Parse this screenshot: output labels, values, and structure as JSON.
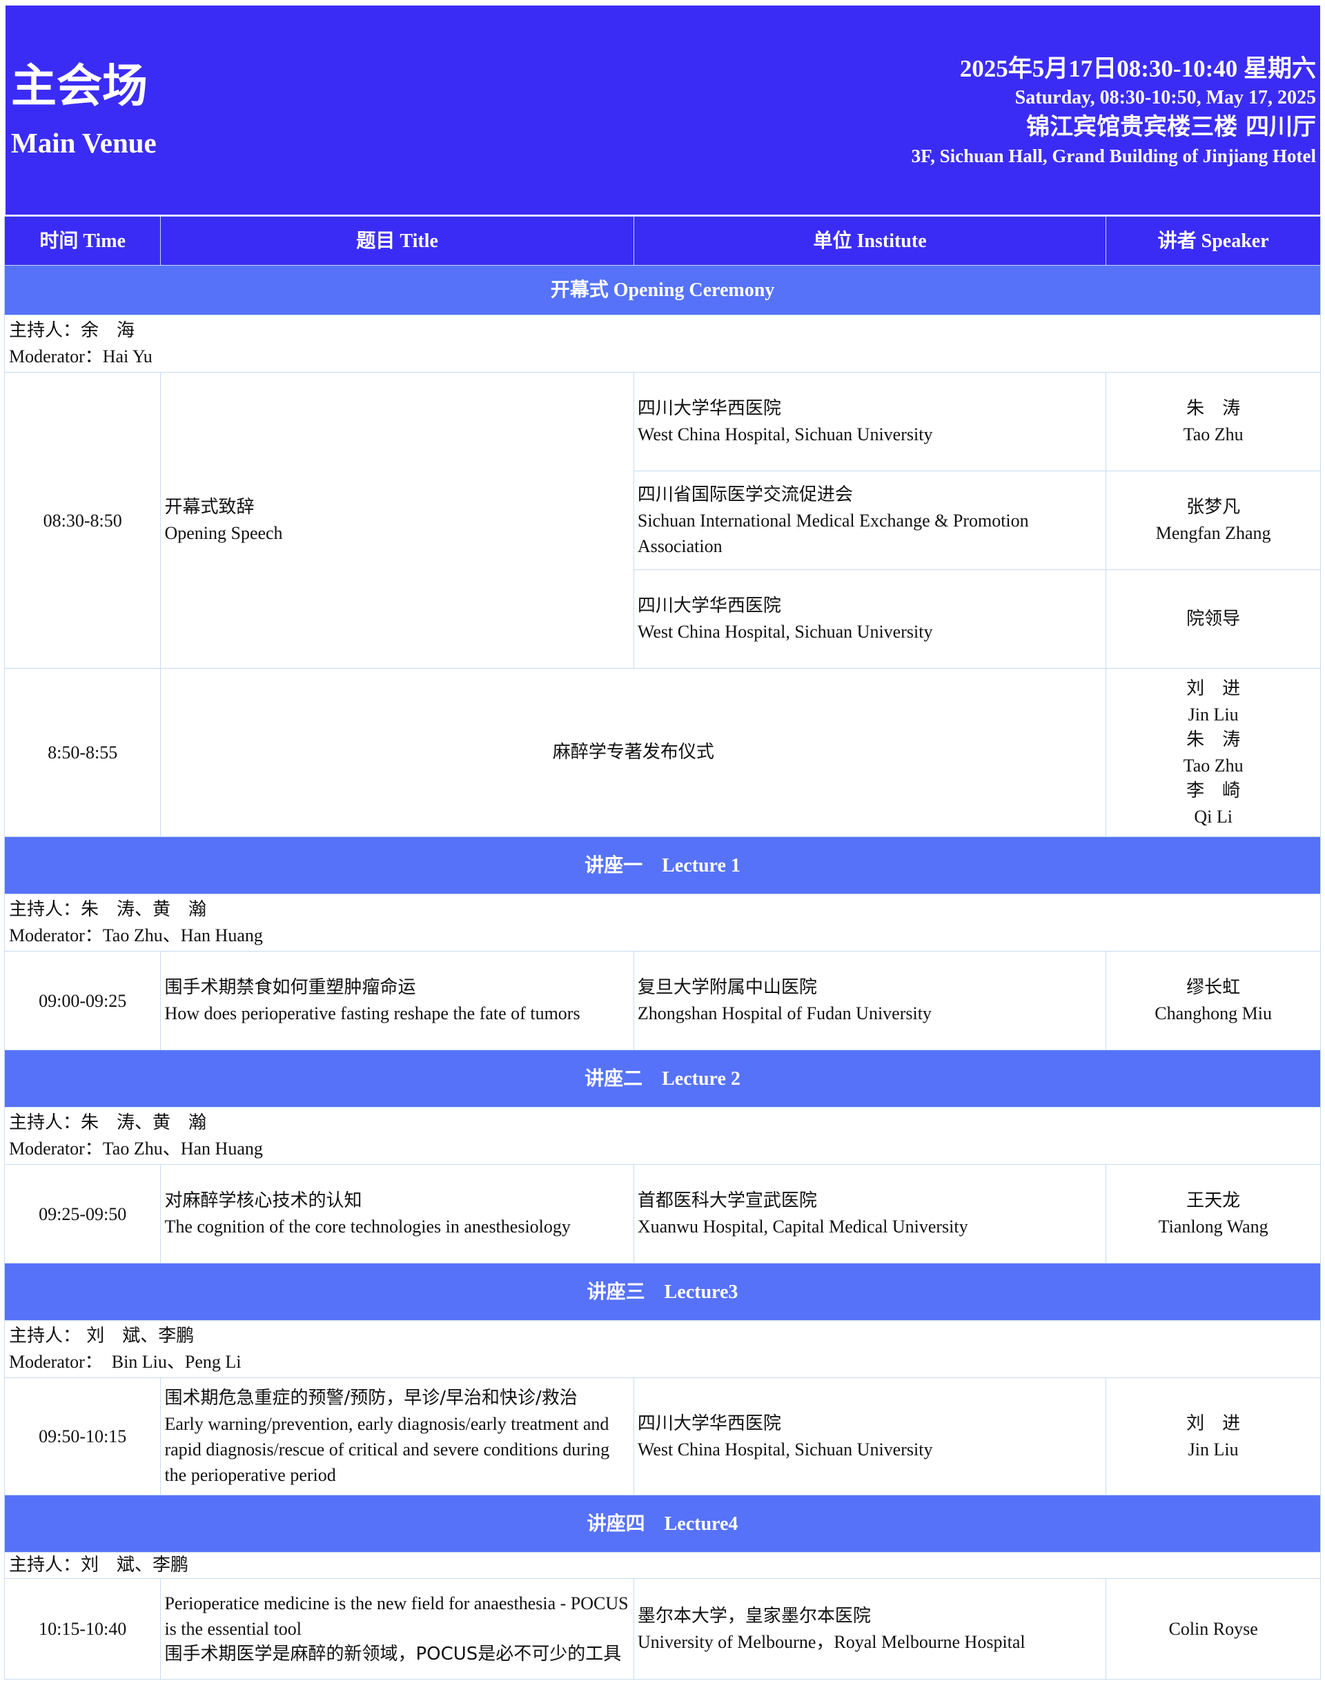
{
  "header": {
    "title_cn": "主会场",
    "title_en": "Main Venue",
    "date_cn": "2025年5月17日08:30-10:40  星期六",
    "date_en": "Saturday, 08:30-10:50, May 17, 2025",
    "location_cn": "锦江宾馆贵宾楼三楼 四川厅",
    "location_en": "3F, Sichuan Hall, Grand Building of Jinjiang Hotel"
  },
  "columns": {
    "time": "时间 Time",
    "title": "题目 Title",
    "institute": "单位 Institute",
    "speaker": "讲者 Speaker"
  },
  "opening": {
    "section": "开幕式 Opening Ceremony",
    "moderator_cn": "主持人：余　海",
    "moderator_en": "Moderator：Hai Yu",
    "speech_time": "08:30-8:50",
    "speech_title_cn": "开幕式致辞",
    "speech_title_en": "Opening Speech",
    "rows": [
      {
        "inst_cn": "四川大学华西医院",
        "inst_en": "West China Hospital, Sichuan University",
        "spk_cn": "朱　涛",
        "spk_en": "Tao Zhu"
      },
      {
        "inst_cn": "四川省国际医学交流促进会",
        "inst_en": "Sichuan International Medical Exchange & Promotion Association",
        "spk_cn": "张梦凡",
        "spk_en": "Mengfan Zhang"
      },
      {
        "inst_cn": "四川大学华西医院",
        "inst_en": "West China Hospital, Sichuan University",
        "spk_cn": "院领导"
      }
    ],
    "release_time": "8:50-8:55",
    "release_title": "麻醉学专著发布仪式",
    "release_speakers": [
      "刘　进",
      "Jin Liu",
      "朱　涛",
      "Tao Zhu",
      "李　崎",
      "Qi Li"
    ]
  },
  "lecture1": {
    "section": "讲座一　Lecture 1",
    "moderator_cn": "主持人：朱　涛、黄　瀚",
    "moderator_en": "Moderator：Tao Zhu、Han Huang",
    "time": "09:00-09:25",
    "title_cn": "围手术期禁食如何重塑肿瘤命运",
    "title_en": "How does perioperative fasting reshape the fate of tumors",
    "inst_cn": "复旦大学附属中山医院",
    "inst_en": "Zhongshan Hospital of Fudan University",
    "spk_cn": "缪长虹",
    "spk_en": "Changhong Miu"
  },
  "lecture2": {
    "section": "讲座二　Lecture 2",
    "moderator_cn": "主持人：朱　涛、黄　瀚",
    "moderator_en": "Moderator：Tao Zhu、Han Huang",
    "time": "09:25-09:50",
    "title_cn": "对麻醉学核心技术的认知",
    "title_en": "The cognition of the core technologies in anesthesiology",
    "inst_cn": "首都医科大学宣武医院",
    "inst_en": "Xuanwu Hospital, Capital Medical University",
    "spk_cn": "王天龙",
    "spk_en": "Tianlong Wang"
  },
  "lecture3": {
    "section": "讲座三　Lecture3",
    "moderator_cn": "主持人：  刘　斌、李鹏",
    "moderator_en": "Moderator：　Bin Liu、Peng Li",
    "time": "09:50-10:15",
    "title_cn": "围术期危急重症的预警/预防，早诊/早治和快诊/救治",
    "title_en": "Early warning/prevention, early diagnosis/early treatment and rapid diagnosis/rescue of critical and severe conditions during the perioperative period",
    "inst_cn": "四川大学华西医院",
    "inst_en": "West China Hospital, Sichuan University",
    "spk_cn": "刘　进",
    "spk_en": "Jin Liu"
  },
  "lecture4": {
    "section": "讲座四　Lecture4",
    "moderator_cn": "主持人：刘　斌、李鹏",
    "time": "10:15-10:40",
    "title_en": "Perioperatice medicine is the new field for anaesthesia - POCUS is the essential tool",
    "title_cn": "围手术期医学是麻醉的新领域，POCUS是必不可少的工具",
    "inst_cn": "墨尔本大学，皇家墨尔本医院",
    "inst_en": "University of Melbourne，Royal Melbourne Hospital",
    "spk_en": "Colin Royse"
  },
  "colors": {
    "header_bg": "#3b2cf5",
    "section_bg": "#5672f8",
    "grid": "#c6dbf2"
  }
}
